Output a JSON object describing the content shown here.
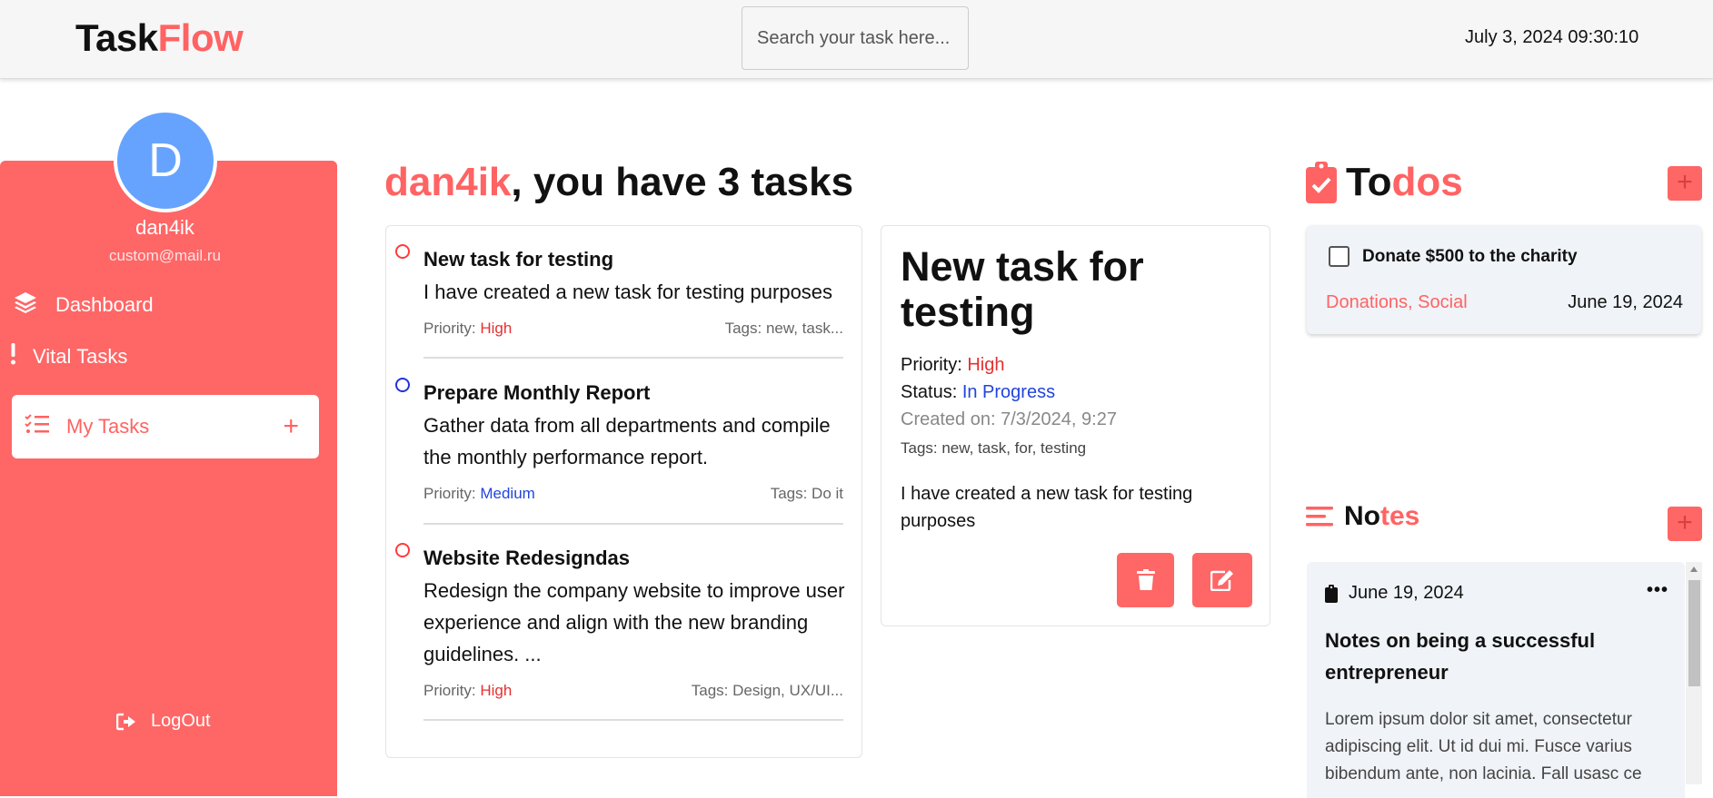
{
  "header": {
    "logo_part1": "Task",
    "logo_part2": "Flow",
    "search_placeholder": "Search your task here...",
    "datetime": "July 3, 2024 09:30:10"
  },
  "user": {
    "avatar_letter": "D",
    "name": "dan4ik",
    "email": "custom@mail.ru"
  },
  "sidebar": {
    "items": [
      {
        "label": "Dashboard",
        "icon": "layers-icon"
      },
      {
        "label": "Vital Tasks",
        "icon": "exclamation-icon"
      },
      {
        "label": "My Tasks",
        "icon": "list-check-icon",
        "active": true
      }
    ],
    "add_symbol": "+",
    "logout_label": "LogOut"
  },
  "main": {
    "greeting_name": "dan4ik",
    "greeting_rest": ", you have 3 tasks",
    "tasks": [
      {
        "title": "New task for testing",
        "description": "I have created a new task for testing purposes",
        "priority_label": "Priority: ",
        "priority": "High",
        "tags": "Tags: new, task..."
      },
      {
        "title": "Prepare Monthly Report",
        "description": "Gather data from all departments and compile the monthly performance report.",
        "priority_label": "Priority: ",
        "priority": "Medium",
        "tags": "Tags: Do it"
      },
      {
        "title": "Website Redesigndas",
        "description": "Redesign the company website to improve user experience and align with the new branding guidelines. ...",
        "priority_label": "Priority: ",
        "priority": "High",
        "tags": "Tags: Design, UX/UI..."
      }
    ]
  },
  "detail": {
    "title": "New task for testing",
    "priority_label": "Priority: ",
    "priority": "High",
    "status_label": "Status: ",
    "status": "In Progress",
    "created": "Created on: 7/3/2024, 9:27",
    "tags": "Tags: new, task, for, testing",
    "description": "I have created a new task for testing purposes"
  },
  "todos": {
    "title_part1": "To",
    "title_part2": "dos",
    "add_symbol": "+",
    "items": [
      {
        "text": "Donate $500 to the charity",
        "tags": "Donations, Social",
        "date": "June 19, 2024"
      }
    ]
  },
  "notes": {
    "title_part1": "No",
    "title_part2": "tes",
    "add_symbol": "+",
    "items": [
      {
        "date": "June 19, 2024",
        "menu": "•••",
        "title": "Notes on being a successful entrepreneur",
        "body": "Lorem ipsum dolor sit amet, consectetur adipiscing elit. Ut id dui mi. Fusce varius bibendum ante, non lacinia. Fall usasc ce"
      }
    ]
  },
  "colors": {
    "accent": "#ff6666",
    "brand": "#ff6363",
    "avatar": "#66a3ff",
    "priority_high": "#e53030",
    "priority_medium": "#2244dd"
  }
}
